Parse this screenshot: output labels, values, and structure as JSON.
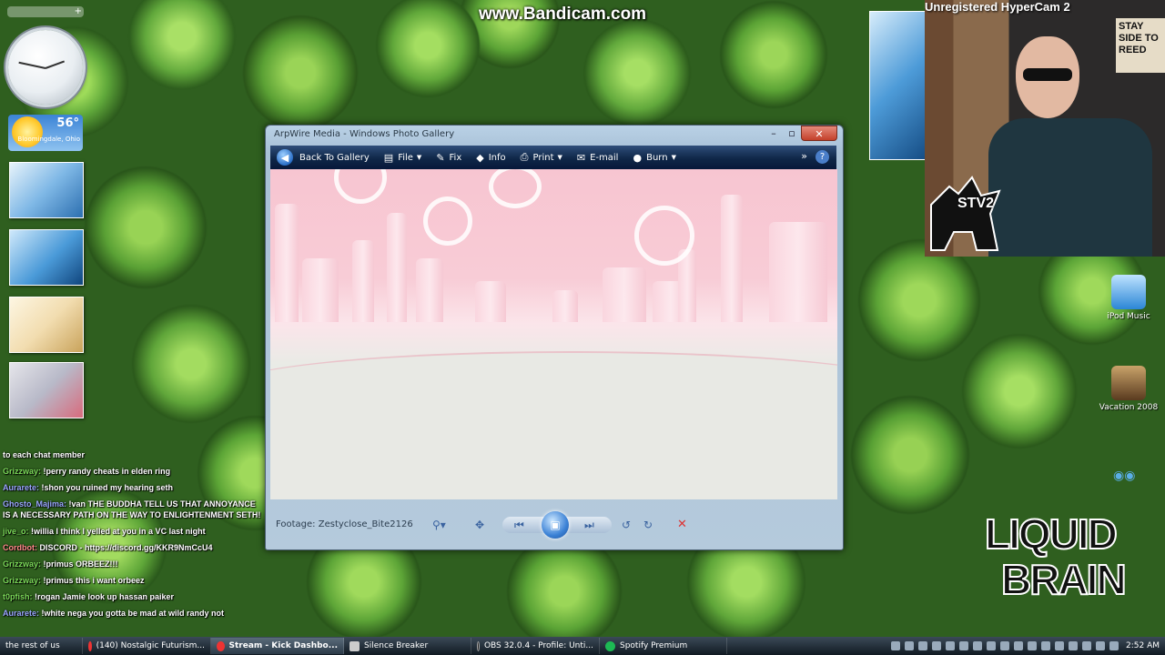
{
  "overlay": {
    "bandicam": "www.Bandicam.com",
    "hypercam": "Unregistered HyperCam 2"
  },
  "gadgets": {
    "weather": {
      "temp": "56°",
      "location": "Bloomingdale, Ohio"
    }
  },
  "window": {
    "title": "ArpWire Media - Windows Photo Gallery",
    "toolbar": {
      "back": "Back To Gallery",
      "file": "File",
      "fix": "Fix",
      "info": "Info",
      "print": "Print",
      "email": "E-mail",
      "burn": "Burn"
    },
    "footer": {
      "filename": "Footage: Zestyclose_Bite2126"
    }
  },
  "webcam": {
    "sign": "STAY SIDE TO REED",
    "logo": "STV2"
  },
  "desktop_icons": [
    {
      "label": "iPod Music"
    },
    {
      "label": "Vacation 2008"
    }
  ],
  "brand": {
    "line1": "LIQUID",
    "line2": "BRAIN"
  },
  "chat": [
    {
      "user": "",
      "text": "to each chat member"
    },
    {
      "user": "Grizzway:",
      "text": "!perry randy cheats in elden ring"
    },
    {
      "user": "Aurarete:",
      "text": "!shon you ruined my hearing seth"
    },
    {
      "user": "Ghosto_Majima:",
      "text": "!van THE BUDDHA TELL US THAT ANNOYANCE IS A NECESSARY PATH ON THE WAY TO ENLIGHTENMENT SETH!"
    },
    {
      "user": "jive_o:",
      "text": "!willia I think I yelled at you in a VC last night"
    },
    {
      "user": "Cordbot:",
      "text": "DISCORD - https://discord.gg/KKR9NmCcU4"
    },
    {
      "user": "Grizzway:",
      "text": "!primus ORBEEZ!!!"
    },
    {
      "user": "Grizzway:",
      "text": "!primus this i want orbeez"
    },
    {
      "user": "t0pfish:",
      "text": "!rogan Jamie look up hassan paiker"
    },
    {
      "user": "Aurarete:",
      "text": "!white nega you gotta be mad at wild randy not"
    }
  ],
  "taskbar": {
    "start": "the rest of us",
    "items": [
      "(140) Nostalgic Futurism...",
      "Stream - Kick Dashbo...",
      "Silence Breaker",
      "OBS 32.0.4 - Profile: Unti...",
      "Spotify Premium"
    ],
    "clock": "2:52 AM"
  },
  "colors": {
    "toolbar": "#0f2748",
    "accent": "#3c82d6"
  }
}
